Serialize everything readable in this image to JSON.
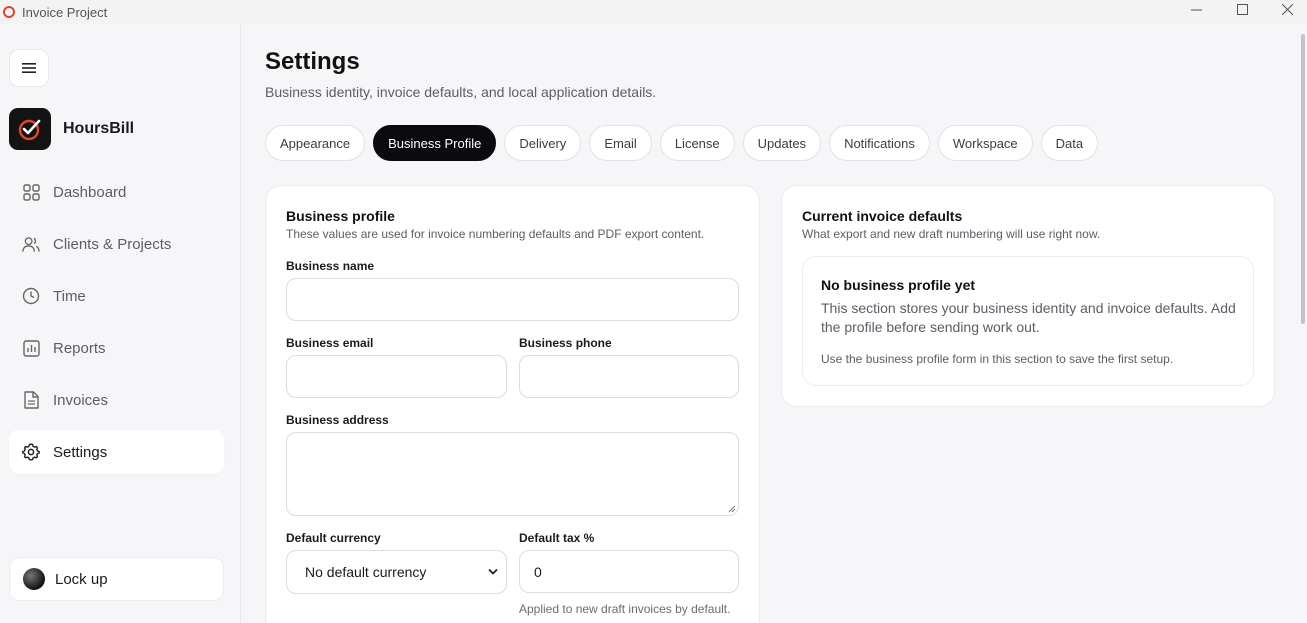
{
  "window": {
    "title": "Invoice Project"
  },
  "sidebar": {
    "brand": "HoursBill",
    "items": [
      {
        "label": "Dashboard",
        "icon": "grid-icon"
      },
      {
        "label": "Clients & Projects",
        "icon": "users-icon"
      },
      {
        "label": "Time",
        "icon": "clock-icon"
      },
      {
        "label": "Reports",
        "icon": "bar-chart-icon"
      },
      {
        "label": "Invoices",
        "icon": "document-icon"
      },
      {
        "label": "Settings",
        "icon": "gear-icon",
        "active": true
      }
    ],
    "lock_label": "Lock up"
  },
  "header": {
    "title": "Settings",
    "subtitle": "Business identity, invoice defaults, and local application details."
  },
  "tabs": [
    {
      "label": "Appearance"
    },
    {
      "label": "Business Profile",
      "active": true
    },
    {
      "label": "Delivery"
    },
    {
      "label": "Email"
    },
    {
      "label": "License"
    },
    {
      "label": "Updates"
    },
    {
      "label": "Notifications"
    },
    {
      "label": "Workspace"
    },
    {
      "label": "Data"
    }
  ],
  "profile_form": {
    "title": "Business profile",
    "subtitle": "These values are used for invoice numbering defaults and PDF export content.",
    "business_name_label": "Business name",
    "business_name_value": "",
    "business_email_label": "Business email",
    "business_email_value": "",
    "business_phone_label": "Business phone",
    "business_phone_value": "",
    "business_address_label": "Business address",
    "business_address_value": "",
    "currency_label": "Default currency",
    "currency_value": "No default currency",
    "tax_label": "Default tax %",
    "tax_value": "0",
    "tax_hint": "Applied to new draft invoices by default."
  },
  "defaults_card": {
    "title": "Current invoice defaults",
    "subtitle": "What export and new draft numbering will use right now.",
    "empty_title": "No business profile yet",
    "empty_body": "This section stores your business identity and invoice defaults. Add the profile before sending work out.",
    "empty_note": "Use the business profile form in this section to save the first setup."
  },
  "colors": {
    "accent": "#e0462f",
    "active_tab_bg": "#0b0b0f",
    "background": "#f6f6f8"
  }
}
